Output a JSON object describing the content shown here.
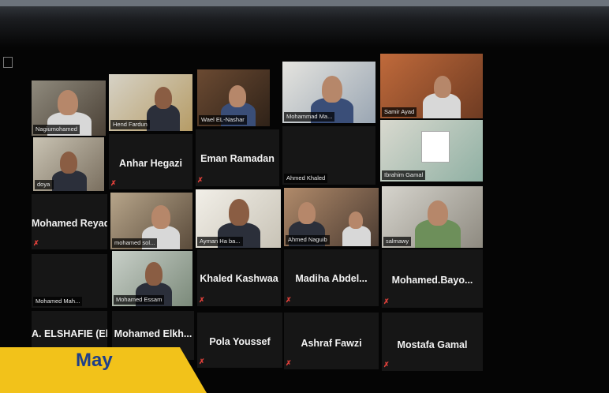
{
  "participants": [
    {
      "name": "Nagiumohamed"
    },
    {
      "name": "Hend Fardun"
    },
    {
      "name": "Wael EL-Nashar"
    },
    {
      "name": "Mohammad Ma..."
    },
    {
      "name": "Samir Ayad"
    },
    {
      "name": "‬doya ‬"
    },
    {
      "name": "Anhar Hegazi"
    },
    {
      "name": "Eman Ramadan"
    },
    {
      "name": "Ahmed Khaled"
    },
    {
      "name": "Ibrahim Gamal"
    },
    {
      "name": "Mohamed Reyad"
    },
    {
      "name": "mohamed sol..."
    },
    {
      "name": "Ayman Ha ba..."
    },
    {
      "name": "Ahmed Naguib"
    },
    {
      "name": "salmawy"
    },
    {
      "name": "Mohamed Mah..."
    },
    {
      "name": "Mohamed Essam"
    },
    {
      "name": "Khaled Kashwaa"
    },
    {
      "name": "Madiha Abdel..."
    },
    {
      "name": "Mohamed.Bayo..."
    },
    {
      "name": "A. ELSHAFIE (El..."
    },
    {
      "name": "Mohamed Elkh..."
    },
    {
      "name": "Pola Youssef"
    },
    {
      "name": "Ashraf Fawzi"
    },
    {
      "name": "Mostafa Gamal"
    }
  ],
  "banner": {
    "label": "May",
    "color": "#f2c21a",
    "text_color": "#1e3f8a"
  },
  "muted_icon": "muted-mic-icon",
  "accent_mute": "#e0403a"
}
